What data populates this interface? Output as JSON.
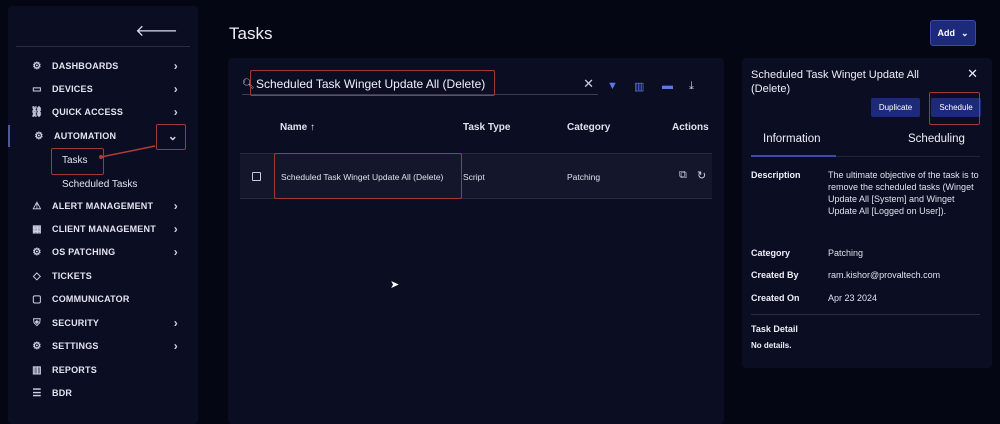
{
  "sidebar": {
    "items": [
      {
        "label": "DASHBOARDS",
        "icon": "dashboard-icon",
        "chevron": "›"
      },
      {
        "label": "DEVICES",
        "icon": "monitor-icon",
        "chevron": "›"
      },
      {
        "label": "QUICK ACCESS",
        "icon": "link-icon",
        "chevron": "›"
      },
      {
        "label": "AUTOMATION",
        "icon": "automation-icon",
        "chevron": "⌄"
      },
      {
        "label": "ALERT MANAGEMENT",
        "icon": "warning-icon",
        "chevron": "›"
      },
      {
        "label": "CLIENT MANAGEMENT",
        "icon": "building-icon",
        "chevron": "›"
      },
      {
        "label": "OS PATCHING",
        "icon": "patch-icon",
        "chevron": "›"
      },
      {
        "label": "TICKETS",
        "icon": "ticket-icon",
        "chevron": ""
      },
      {
        "label": "COMMUNICATOR",
        "icon": "chat-icon",
        "chevron": ""
      },
      {
        "label": "SECURITY",
        "icon": "shield-icon",
        "chevron": "›"
      },
      {
        "label": "SETTINGS",
        "icon": "gear-icon",
        "chevron": "›"
      },
      {
        "label": "REPORTS",
        "icon": "reports-icon",
        "chevron": ""
      },
      {
        "label": "BDR",
        "icon": "database-icon",
        "chevron": ""
      }
    ],
    "sub_items": {
      "tasks": "Tasks",
      "scheduled_tasks": "Scheduled Tasks"
    }
  },
  "page": {
    "title": "Tasks",
    "add_label": "Add"
  },
  "search": {
    "value": "Scheduled Task Winget Update All (Delete)"
  },
  "table": {
    "headers": {
      "name": "Name ↑",
      "task_type": "Task Type",
      "category": "Category",
      "actions": "Actions"
    },
    "rows": [
      {
        "name": "Scheduled Task Winget Update All (Delete)",
        "task_type": "Script",
        "category": "Patching"
      }
    ]
  },
  "details": {
    "title": "Scheduled Task Winget Update All (Delete)",
    "duplicate_label": "Duplicate",
    "schedule_label": "Schedule",
    "tabs": [
      "Information",
      "Scheduling"
    ],
    "fields": {
      "description_label": "Description",
      "description": "The ultimate objective of the task is to remove the scheduled tasks (Winget Update All [System] and Winget Update All [Logged on User]).",
      "category_label": "Category",
      "category": "Patching",
      "created_by_label": "Created By",
      "created_by": "ram.kishor@provaltech.com",
      "created_on_label": "Created On",
      "created_on": "Apr 23 2024"
    },
    "task_detail_label": "Task Detail",
    "task_detail": "No details."
  },
  "colors": {
    "background": "#050613",
    "panel": "#0b0d22",
    "accent": "#1d2a7a",
    "highlight": "#a3383a",
    "toolbar_icon": "#5b78e8"
  }
}
